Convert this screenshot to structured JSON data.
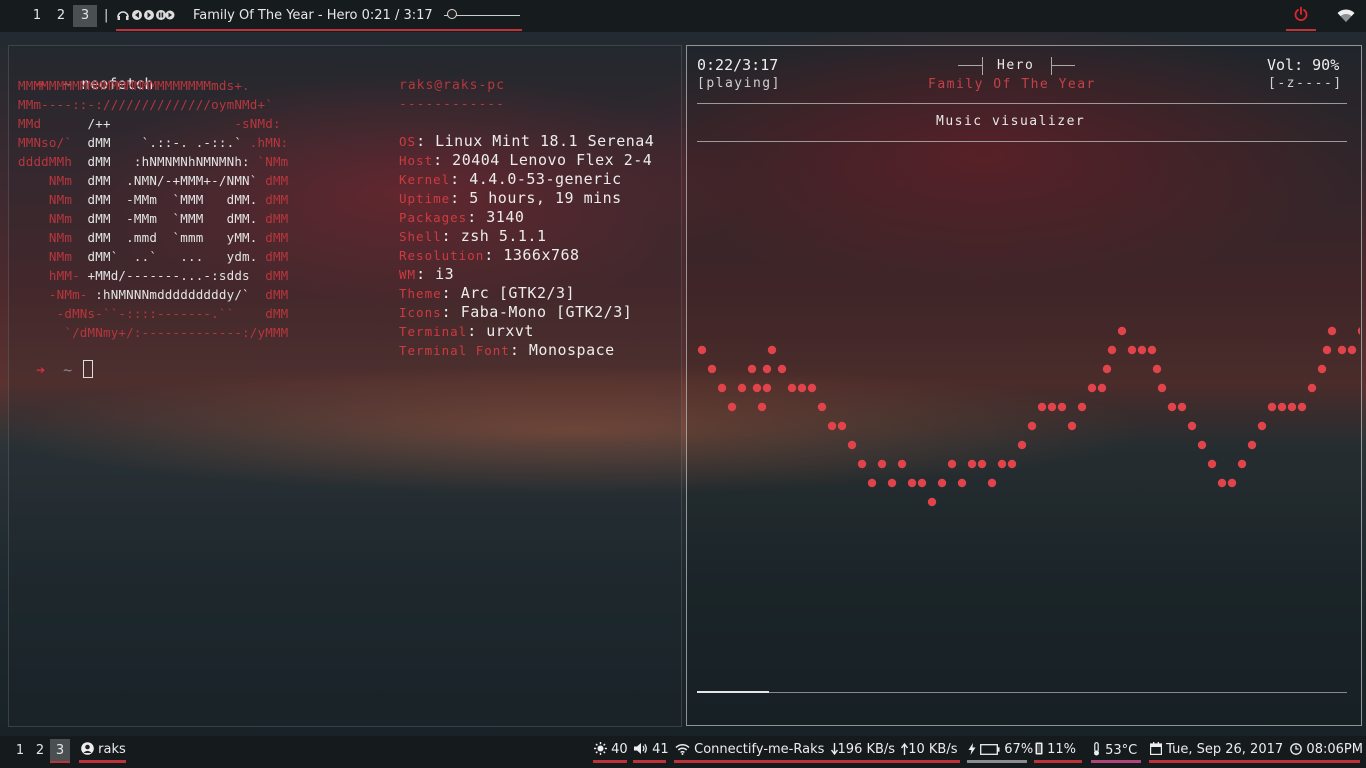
{
  "topbar": {
    "workspaces": [
      {
        "label": "1"
      },
      {
        "label": "2"
      },
      {
        "label": "3",
        "active": true
      }
    ],
    "separator": "|",
    "media_controls": "♫ ⏮ ⏯ ⏸ ⏭",
    "now_playing": "Family Of The Year - Hero 0:21 / 3:17",
    "seek_progress": 0.11,
    "icons": [
      "headphones-icon",
      "previous-icon",
      "play-icon",
      "pause-icon",
      "next-icon",
      "power-icon",
      "wifi-icon"
    ]
  },
  "terminal": {
    "prompt_symbol": "➔",
    "prompt_dir": "~",
    "command": "neofetch",
    "logo_lines": [
      [
        [
          "r",
          "MMMMMMMMMMMMMMMMMMMMMMMMMmds+."
        ]
      ],
      [
        [
          "r",
          "MMm----::-://////////////oymNMd+`"
        ]
      ],
      [
        [
          "r",
          "MMd      "
        ],
        [
          "w",
          "/++"
        ],
        [
          "r",
          "                -sNMd:"
        ]
      ],
      [
        [
          "r",
          "MMNso/`  "
        ],
        [
          "w",
          "dMM    `.::-. .-::.` "
        ],
        [
          "r",
          ".hMN:"
        ]
      ],
      [
        [
          "r",
          "ddddMMh  "
        ],
        [
          "w",
          "dMM   :hNMNMNhNMNMNh: "
        ],
        [
          "r",
          "`NMm"
        ]
      ],
      [
        [
          "r",
          "    NMm  "
        ],
        [
          "w",
          "dMM  .NMN/-+MMM+-/NMN` "
        ],
        [
          "r",
          "dMM"
        ]
      ],
      [
        [
          "r",
          "    NMm  "
        ],
        [
          "w",
          "dMM  -MMm  `MMM   dMM. "
        ],
        [
          "r",
          "dMM"
        ]
      ],
      [
        [
          "r",
          "    NMm  "
        ],
        [
          "w",
          "dMM  -MMm  `MMM   dMM. "
        ],
        [
          "r",
          "dMM"
        ]
      ],
      [
        [
          "r",
          "    NMm  "
        ],
        [
          "w",
          "dMM  .mmd  `mmm   yMM. "
        ],
        [
          "r",
          "dMM"
        ]
      ],
      [
        [
          "r",
          "    NMm  "
        ],
        [
          "w",
          "dMM`  ..`   ...   ydm. "
        ],
        [
          "r",
          "dMM"
        ]
      ],
      [
        [
          "r",
          "    hMM- "
        ],
        [
          "w",
          "+MMd/-------...-:sdds  "
        ],
        [
          "r",
          "dMM"
        ]
      ],
      [
        [
          "r",
          "    -NMm- "
        ],
        [
          "w",
          ":hNMNNNmdddddddddy/`  "
        ],
        [
          "r",
          "dMM"
        ]
      ],
      [
        [
          "r",
          "     -dMNs-``-::::-------.``    "
        ],
        [
          "r",
          "dMM"
        ]
      ],
      [
        [
          "r",
          "      `/dMNmy+/:-------------:/yMMM"
        ]
      ]
    ],
    "user_host": "raks@raks-pc",
    "divider": "------------",
    "info": [
      {
        "key": "OS",
        "value": "Linux Mint 18.1 Serena4"
      },
      {
        "key": "Host",
        "value": "20404 Lenovo Flex 2-4"
      },
      {
        "key": "Kernel",
        "value": "4.4.0-53-generic"
      },
      {
        "key": "Uptime",
        "value": "5 hours, 19 mins"
      },
      {
        "key": "Packages",
        "value": "3140"
      },
      {
        "key": "Shell",
        "value": "zsh 5.1.1"
      },
      {
        "key": "Resolution",
        "value": "1366x768"
      },
      {
        "key": "WM",
        "value": "i3"
      },
      {
        "key": "Theme",
        "value": "Arc [GTK2/3]"
      },
      {
        "key": "Icons",
        "value": "Faba-Mono [GTK2/3]"
      },
      {
        "key": "Terminal",
        "value": "urxvt"
      },
      {
        "key": "Terminal Font",
        "value": "Monospace"
      }
    ]
  },
  "player": {
    "elapsed": "0:22/3:17",
    "state": "[playing]",
    "song_title": "Hero",
    "album": "Family Of The Year",
    "volume": "Vol: 90%",
    "flags": "[-z----]",
    "visualizer_title": "Music visualizer",
    "progress": 0.11,
    "visualizer_levels": [
      10,
      9,
      8,
      7,
      8,
      9,
      7,
      10,
      9,
      8,
      8,
      8,
      7,
      6,
      6,
      5,
      4,
      3,
      4,
      3,
      4,
      3,
      3,
      2,
      3,
      4,
      3,
      4,
      4,
      3,
      4,
      4,
      5,
      6,
      7,
      7,
      7,
      6,
      7,
      8,
      8,
      10,
      11,
      10,
      10,
      10,
      8,
      7,
      7,
      6,
      5,
      4,
      3,
      3,
      4,
      5,
      6,
      7,
      7,
      7,
      7,
      8,
      9,
      11,
      10,
      10,
      11,
      10,
      8,
      7,
      6
    ]
  },
  "bottombar": {
    "workspaces": [
      {
        "label": "1"
      },
      {
        "label": "2"
      },
      {
        "label": "3",
        "active": true
      }
    ],
    "user": "raks",
    "brightness": "40",
    "volume": "41",
    "wifi": "Connectify-me-Raks",
    "down_speed": "196 KB/s",
    "up_speed": "10 KB/s",
    "battery": "67%",
    "cpu": "11%",
    "temperature": "53°C",
    "date": "Tue, Sep 26, 2017",
    "time": "08:06PM"
  },
  "colors": {
    "accent": "#c0323a",
    "terminal_red": "#d9333a",
    "visualizer_dot": "#e0434a",
    "bar_bg": "#161a1d"
  }
}
